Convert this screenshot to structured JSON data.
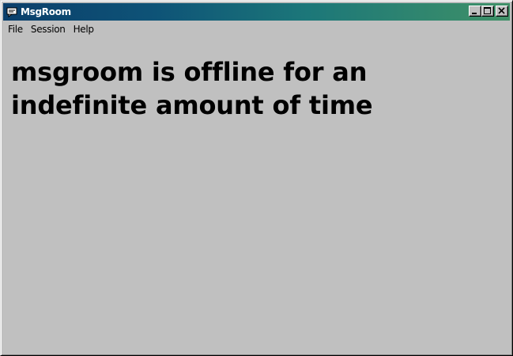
{
  "window": {
    "title": "MsgRoom",
    "app_icon": "chat-bubble-icon",
    "controls": {
      "minimize_icon": "minimize-icon",
      "maximize_icon": "maximize-icon",
      "close_icon": "close-icon"
    }
  },
  "menu": {
    "items": [
      {
        "label": "File"
      },
      {
        "label": "Session"
      },
      {
        "label": "Help"
      }
    ]
  },
  "main": {
    "message": "msgroom is offline for an indefinite amount of time"
  },
  "colors": {
    "titlebar_start": "#0b3f6b",
    "titlebar_end": "#3f9167",
    "window_bg": "#c0c0c0",
    "title_text": "#ffffff"
  }
}
